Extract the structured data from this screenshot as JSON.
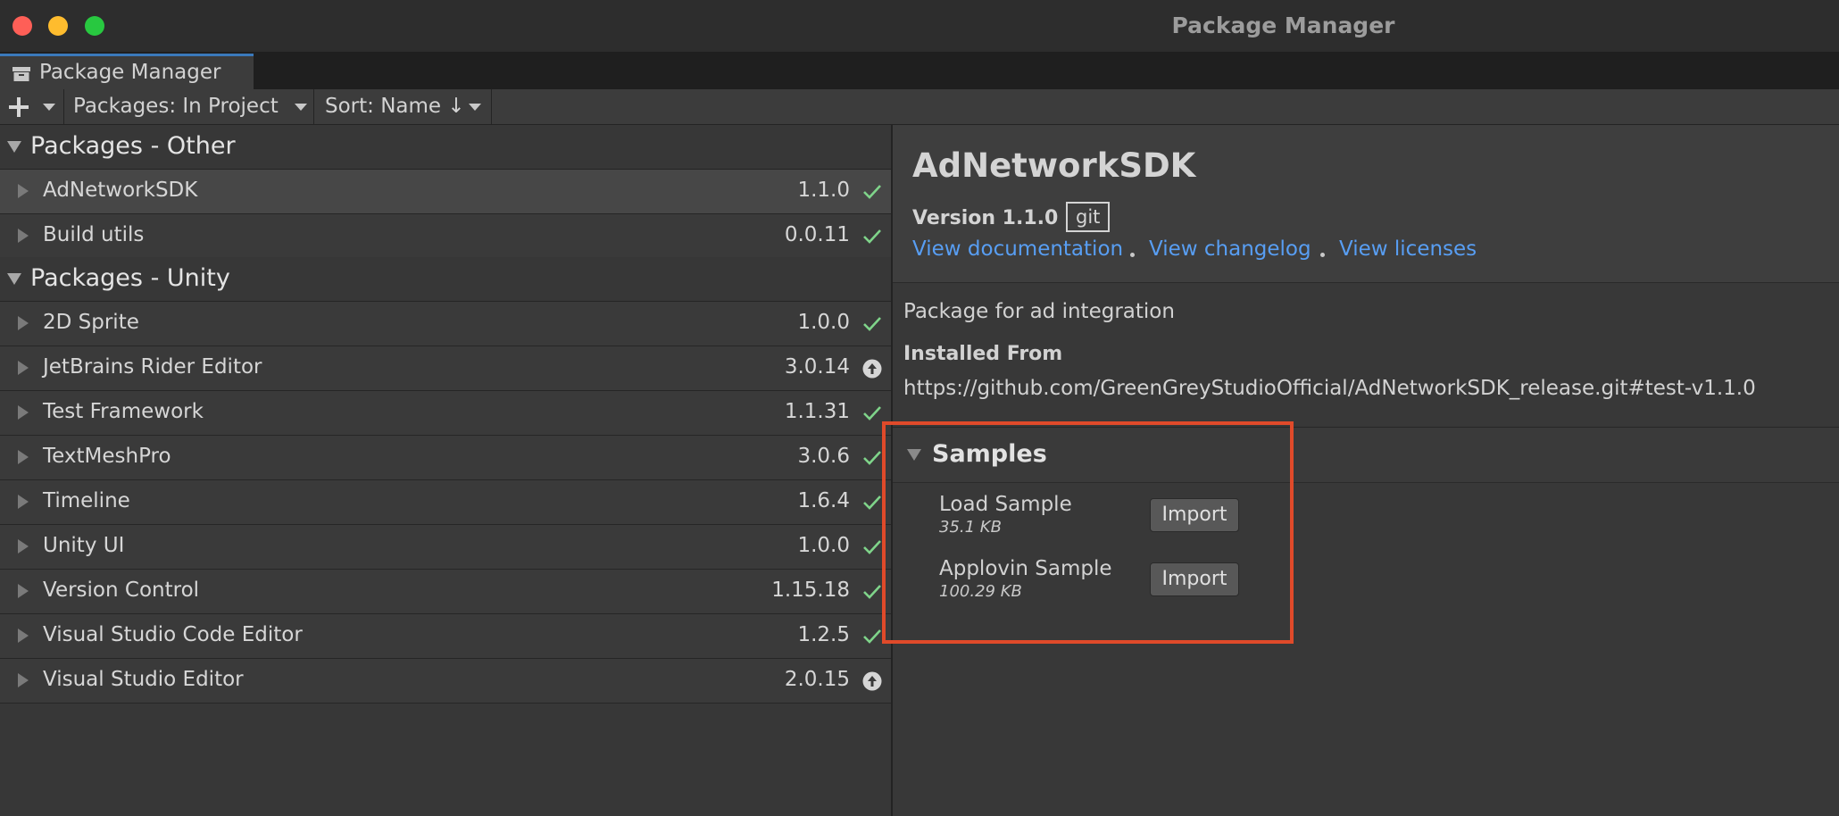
{
  "window": {
    "title": "Package Manager",
    "traffic_lights": [
      "#fe5f57",
      "#febc2e",
      "#28c840"
    ]
  },
  "tab": {
    "label": "Package Manager",
    "icon": "package-icon"
  },
  "toolbar": {
    "add_icon": "plus-icon",
    "packages_filter": "Packages: In Project",
    "sort": "Sort: Name ↓"
  },
  "groups": [
    {
      "label": "Packages - Other",
      "items": [
        {
          "name": "AdNetworkSDK",
          "version": "1.1.0",
          "status": "installed"
        },
        {
          "name": "Build utils",
          "version": "0.0.11",
          "status": "installed"
        }
      ]
    },
    {
      "label": "Packages - Unity",
      "items": [
        {
          "name": "2D Sprite",
          "version": "1.0.0",
          "status": "installed"
        },
        {
          "name": "JetBrains Rider Editor",
          "version": "3.0.14",
          "status": "update-available"
        },
        {
          "name": "Test Framework",
          "version": "1.1.31",
          "status": "installed"
        },
        {
          "name": "TextMeshPro",
          "version": "3.0.6",
          "status": "installed"
        },
        {
          "name": "Timeline",
          "version": "1.6.4",
          "status": "installed"
        },
        {
          "name": "Unity UI",
          "version": "1.0.0",
          "status": "installed"
        },
        {
          "name": "Version Control",
          "version": "1.15.18",
          "status": "installed"
        },
        {
          "name": "Visual Studio Code Editor",
          "version": "1.2.5",
          "status": "installed"
        },
        {
          "name": "Visual Studio Editor",
          "version": "2.0.15",
          "status": "update-available"
        }
      ]
    }
  ],
  "details": {
    "title": "AdNetworkSDK",
    "version_label": "Version 1.1.0",
    "source_badge": "git",
    "links": [
      "View documentation",
      "View changelog",
      "View licenses"
    ],
    "description": "Package for ad integration",
    "installed_from_label": "Installed From",
    "installed_from_url": "https://github.com/GreenGreyStudioOfficial/AdNetworkSDK_release.git#test-v1.1.0",
    "samples_label": "Samples",
    "samples": [
      {
        "name": "Load Sample",
        "size": "35.1 KB",
        "button": "Import"
      },
      {
        "name": "Applovin Sample",
        "size": "100.29 KB",
        "button": "Import"
      }
    ]
  },
  "colors": {
    "link": "#589ef3",
    "check": "#7fd48a",
    "highlight_box": "#e04a2a",
    "tab_accent": "#3a79bb"
  }
}
